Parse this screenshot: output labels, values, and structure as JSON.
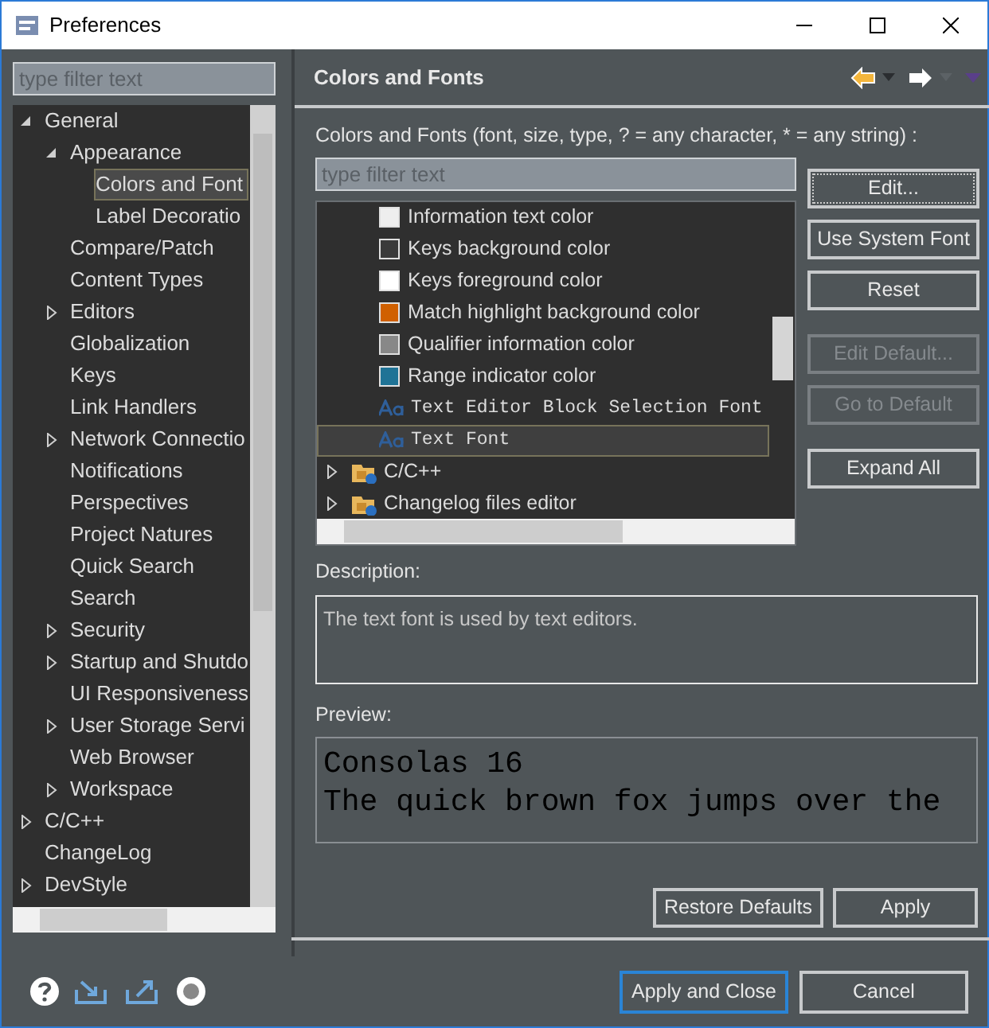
{
  "window": {
    "title": "Preferences"
  },
  "sidebar": {
    "filter": {
      "placeholder": "type filter text"
    },
    "tree": [
      {
        "label": "General",
        "expanded": true,
        "selected": false,
        "children": [
          {
            "label": "Appearance",
            "expanded": true,
            "selected": false,
            "children": [
              {
                "label": "Colors and Font",
                "selected": true
              },
              {
                "label": "Label Decoratio",
                "selected": false
              }
            ]
          },
          {
            "label": "Compare/Patch",
            "selected": false
          },
          {
            "label": "Content Types",
            "selected": false
          },
          {
            "label": "Editors",
            "expanded": false,
            "selected": false
          },
          {
            "label": "Globalization",
            "selected": false
          },
          {
            "label": "Keys",
            "selected": false
          },
          {
            "label": "Link Handlers",
            "selected": false
          },
          {
            "label": "Network Connectio",
            "expanded": false,
            "selected": false
          },
          {
            "label": "Notifications",
            "selected": false
          },
          {
            "label": "Perspectives",
            "selected": false
          },
          {
            "label": "Project Natures",
            "selected": false
          },
          {
            "label": "Quick Search",
            "selected": false
          },
          {
            "label": "Search",
            "selected": false
          },
          {
            "label": "Security",
            "expanded": false,
            "selected": false
          },
          {
            "label": "Startup and Shutdo",
            "expanded": false,
            "selected": false
          },
          {
            "label": "UI Responsiveness",
            "selected": false
          },
          {
            "label": "User Storage Servi",
            "expanded": false,
            "selected": false
          },
          {
            "label": "Web Browser",
            "selected": false
          },
          {
            "label": "Workspace",
            "expanded": false,
            "selected": false
          }
        ]
      },
      {
        "label": "C/C++",
        "expanded": false,
        "selected": false
      },
      {
        "label": "ChangeLog",
        "selected": false
      },
      {
        "label": "DevStyle",
        "expanded": false,
        "selected": false
      }
    ]
  },
  "page": {
    "title": "Colors and Fonts",
    "intro": "Colors and Fonts (font, size, type, ? = any character, * = any string) :",
    "filter": {
      "placeholder": "type filter text"
    },
    "entries": [
      {
        "kind": "color",
        "label": "Information text color",
        "color": "#eeeeee",
        "selected": false
      },
      {
        "kind": "color",
        "label": "Keys background color",
        "color": "#3a3a3a",
        "selected": false
      },
      {
        "kind": "color",
        "label": "Keys foreground color",
        "color": "#ffffff",
        "selected": false
      },
      {
        "kind": "color",
        "label": "Match highlight background color",
        "color": "#d06000",
        "selected": false
      },
      {
        "kind": "color",
        "label": "Qualifier information color",
        "color": "#888888",
        "selected": false
      },
      {
        "kind": "color",
        "label": "Range indicator color",
        "color": "#1f7396",
        "selected": false
      },
      {
        "kind": "font",
        "label": "Text Editor Block Selection Font",
        "selected": false
      },
      {
        "kind": "font",
        "label": "Text Font",
        "selected": true
      },
      {
        "kind": "category",
        "label": "C/C++",
        "expanded": false,
        "selected": false
      },
      {
        "kind": "category",
        "label": "Changelog files editor",
        "expanded": false,
        "selected": false
      }
    ],
    "side_buttons": [
      {
        "label": "Edit...",
        "disabled": false,
        "focused": true
      },
      {
        "label": "Use System Font",
        "disabled": false,
        "focused": false
      },
      {
        "label": "Reset",
        "disabled": false,
        "focused": false
      },
      {
        "label": "Edit Default...",
        "disabled": true,
        "focused": false
      },
      {
        "label": "Go to Default",
        "disabled": true,
        "focused": false
      },
      {
        "label": "Expand All",
        "disabled": false,
        "focused": false
      }
    ],
    "description_label": "Description:",
    "description": "The text font is used by text editors.",
    "preview_label": "Preview:",
    "preview_lines": [
      "Consolas 16",
      "The quick brown fox jumps over the"
    ],
    "buttons": [
      "Restore Defaults",
      "Apply"
    ]
  },
  "footer_buttons": [
    {
      "label": "Apply and Close",
      "default": true
    },
    {
      "label": "Cancel",
      "default": false
    }
  ]
}
